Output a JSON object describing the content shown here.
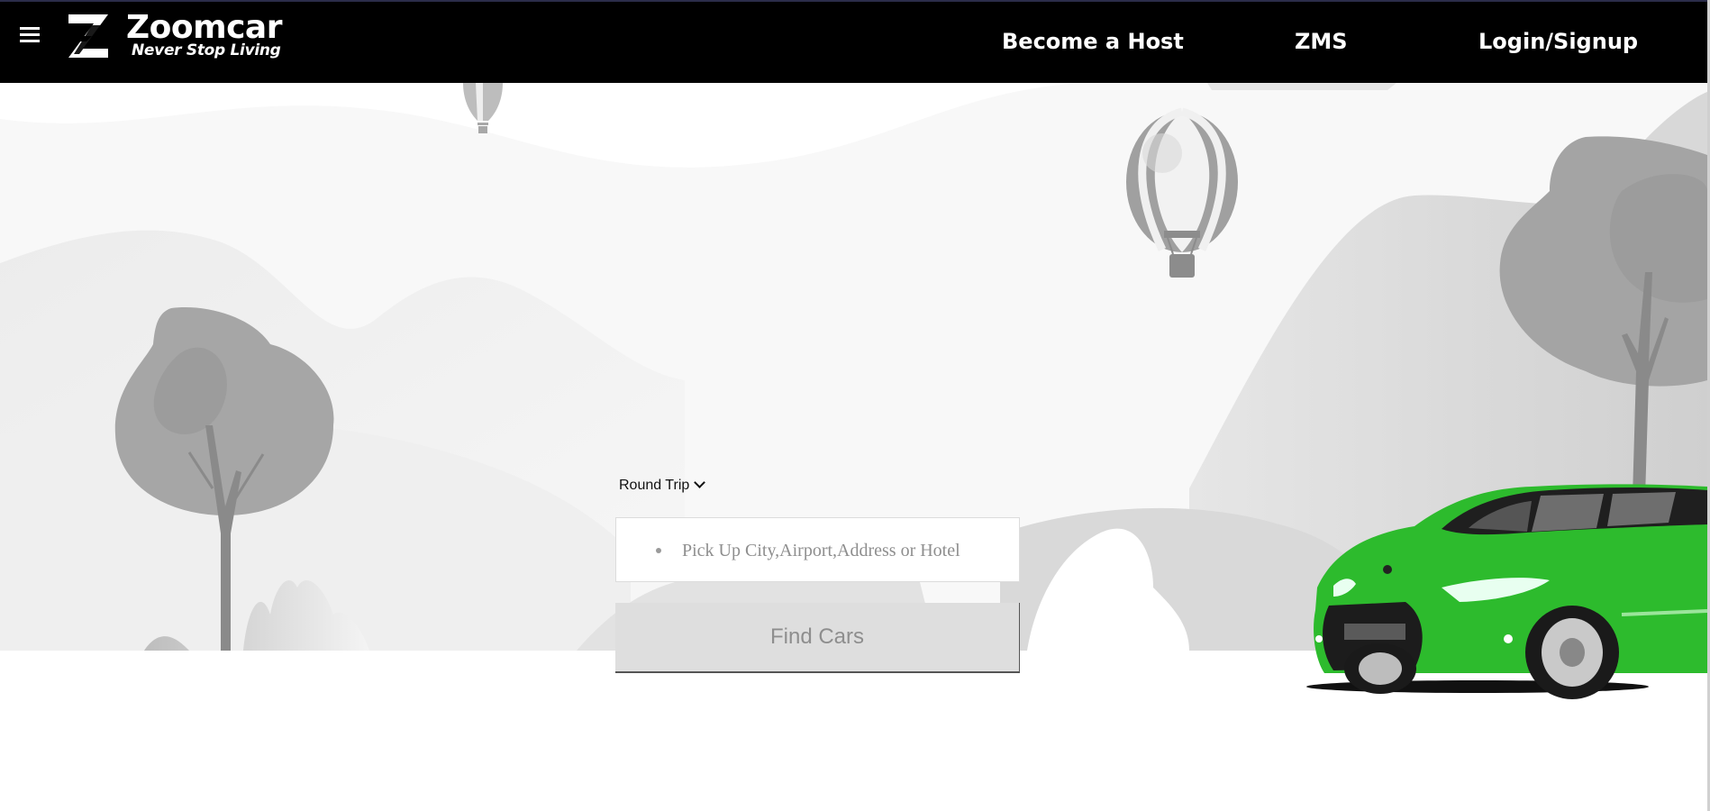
{
  "header": {
    "brand_name": "Zoomcar",
    "tagline": "Never Stop Living",
    "menu_icon": "hamburger-icon",
    "logo_icon": "zoomcar-z-logo",
    "nav": [
      {
        "label": "Become a Host"
      },
      {
        "label": "ZMS"
      },
      {
        "label": "Login/Signup"
      }
    ]
  },
  "search": {
    "trip_type": "Round Trip",
    "location_placeholder": "Pick Up City,Airport,Address or Hotel",
    "location_value": "",
    "submit_label": "Find Cars"
  },
  "colors": {
    "header_bg": "#000000",
    "car_accent": "#2dbb2d",
    "button_bg": "#dedede"
  }
}
